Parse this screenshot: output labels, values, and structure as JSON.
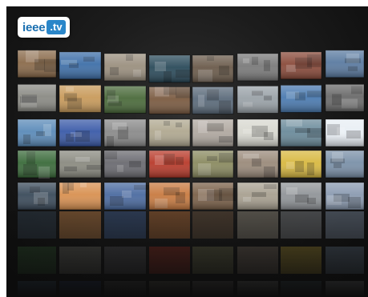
{
  "app": {
    "logo_text": "ieee",
    "logo_badge": ".tv",
    "accent_color": "#2a86c9"
  },
  "tile_wall": {
    "rows": 5,
    "columns": 8,
    "tiles": [
      {
        "subject": "aerial-ship",
        "tone": "#8a6a4a"
      },
      {
        "subject": "jet-in-sky",
        "tone": "#3e6fa8"
      },
      {
        "subject": "presenter-lab",
        "tone": "#9a8f7e"
      },
      {
        "subject": "dark-lab-equipment",
        "tone": "#2a4a5a"
      },
      {
        "subject": "interview-man",
        "tone": "#6a5a4a"
      },
      {
        "subject": "crowd-bw",
        "tone": "#7a7a7a"
      },
      {
        "subject": "people-stage",
        "tone": "#8a4a3a"
      },
      {
        "subject": "speaker-suit",
        "tone": "#5a7aa0"
      },
      {
        "subject": "building-bw",
        "tone": "#8a8a84"
      },
      {
        "subject": "beach-people",
        "tone": "#c89a5a"
      },
      {
        "subject": "circuit-board",
        "tone": "#4a6a3a"
      },
      {
        "subject": "man-glasses",
        "tone": "#7a5a40"
      },
      {
        "subject": "lab-room",
        "tone": "#5a6a7a"
      },
      {
        "subject": "walking-people",
        "tone": "#9aa2a8"
      },
      {
        "subject": "solar-field",
        "tone": "#4a7ab0"
      },
      {
        "subject": "machine-bw",
        "tone": "#6a6a6a"
      },
      {
        "subject": "sea-platform",
        "tone": "#5a8ab8"
      },
      {
        "subject": "news-anchor",
        "tone": "#3a5aa8"
      },
      {
        "subject": "mesh-pattern",
        "tone": "#8a8a8a"
      },
      {
        "subject": "robot",
        "tone": "#b0a890"
      },
      {
        "subject": "doctor-scene",
        "tone": "#b0a8a0"
      },
      {
        "subject": "table-document",
        "tone": "#d8d8d0"
      },
      {
        "subject": "hands-screen",
        "tone": "#6a8a9a"
      },
      {
        "subject": "intel-logo",
        "tone": "#e8eef4"
      },
      {
        "subject": "older-man-portrait",
        "tone": "#3a6a3a"
      },
      {
        "subject": "engine-bw",
        "tone": "#8a8a80"
      },
      {
        "subject": "workers-room",
        "tone": "#6a6a70"
      },
      {
        "subject": "red-flowers",
        "tone": "#b83a2a"
      },
      {
        "subject": "electronics",
        "tone": "#8a8a60"
      },
      {
        "subject": "man-office",
        "tone": "#9a8a7a"
      },
      {
        "subject": "yellow-device",
        "tone": "#d8b840"
      },
      {
        "subject": "crowd-outdoor",
        "tone": "#7a90a8"
      },
      {
        "subject": "microscope-dark",
        "tone": "#3a4a5a"
      },
      {
        "subject": "sunset-city",
        "tone": "#d89050"
      },
      {
        "subject": "satellite",
        "tone": "#4a6aa0"
      },
      {
        "subject": "orange-panel",
        "tone": "#c87a40"
      },
      {
        "subject": "museum-room",
        "tone": "#7a6048"
      },
      {
        "subject": "hall-frames",
        "tone": "#a8a090"
      },
      {
        "subject": "factory-bw",
        "tone": "#909498"
      },
      {
        "subject": "city-skyline",
        "tone": "#8a9ab0"
      }
    ]
  }
}
